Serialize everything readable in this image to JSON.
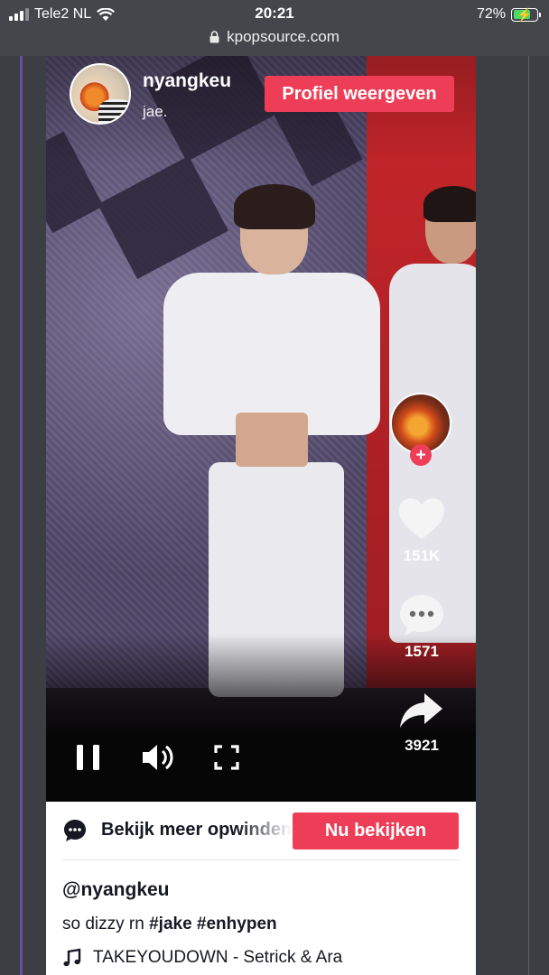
{
  "status_bar": {
    "carrier": "Tele2 NL",
    "time": "20:21",
    "battery_percent": "72%",
    "battery_level": 0.72,
    "url": "kpopsource.com"
  },
  "video": {
    "username": "nyangkeu",
    "nickname": "jae.",
    "profile_button": "Profiel weergeven",
    "likes": "151K",
    "comments": "1571",
    "shares": "3921"
  },
  "cta": {
    "text": "Bekijk meer opwindende",
    "button": "Nu bekijken"
  },
  "post": {
    "author": "@nyangkeu",
    "caption_text": "so dizzy rn ",
    "hashtags": [
      "#jake",
      "#enhypen"
    ],
    "music": "TAKEYOUDOWN - Setrick & Ara"
  },
  "colors": {
    "accent": "#ee3e57",
    "text_dark": "#161823",
    "page_bg": "#3b3e43"
  },
  "icons": [
    "signal-icon",
    "wifi-icon",
    "battery-icon",
    "lock-icon",
    "heart-icon",
    "comment-icon",
    "share-icon",
    "pause-icon",
    "volume-icon",
    "fullscreen-icon",
    "chat-bubble-icon",
    "music-note-icon"
  ]
}
